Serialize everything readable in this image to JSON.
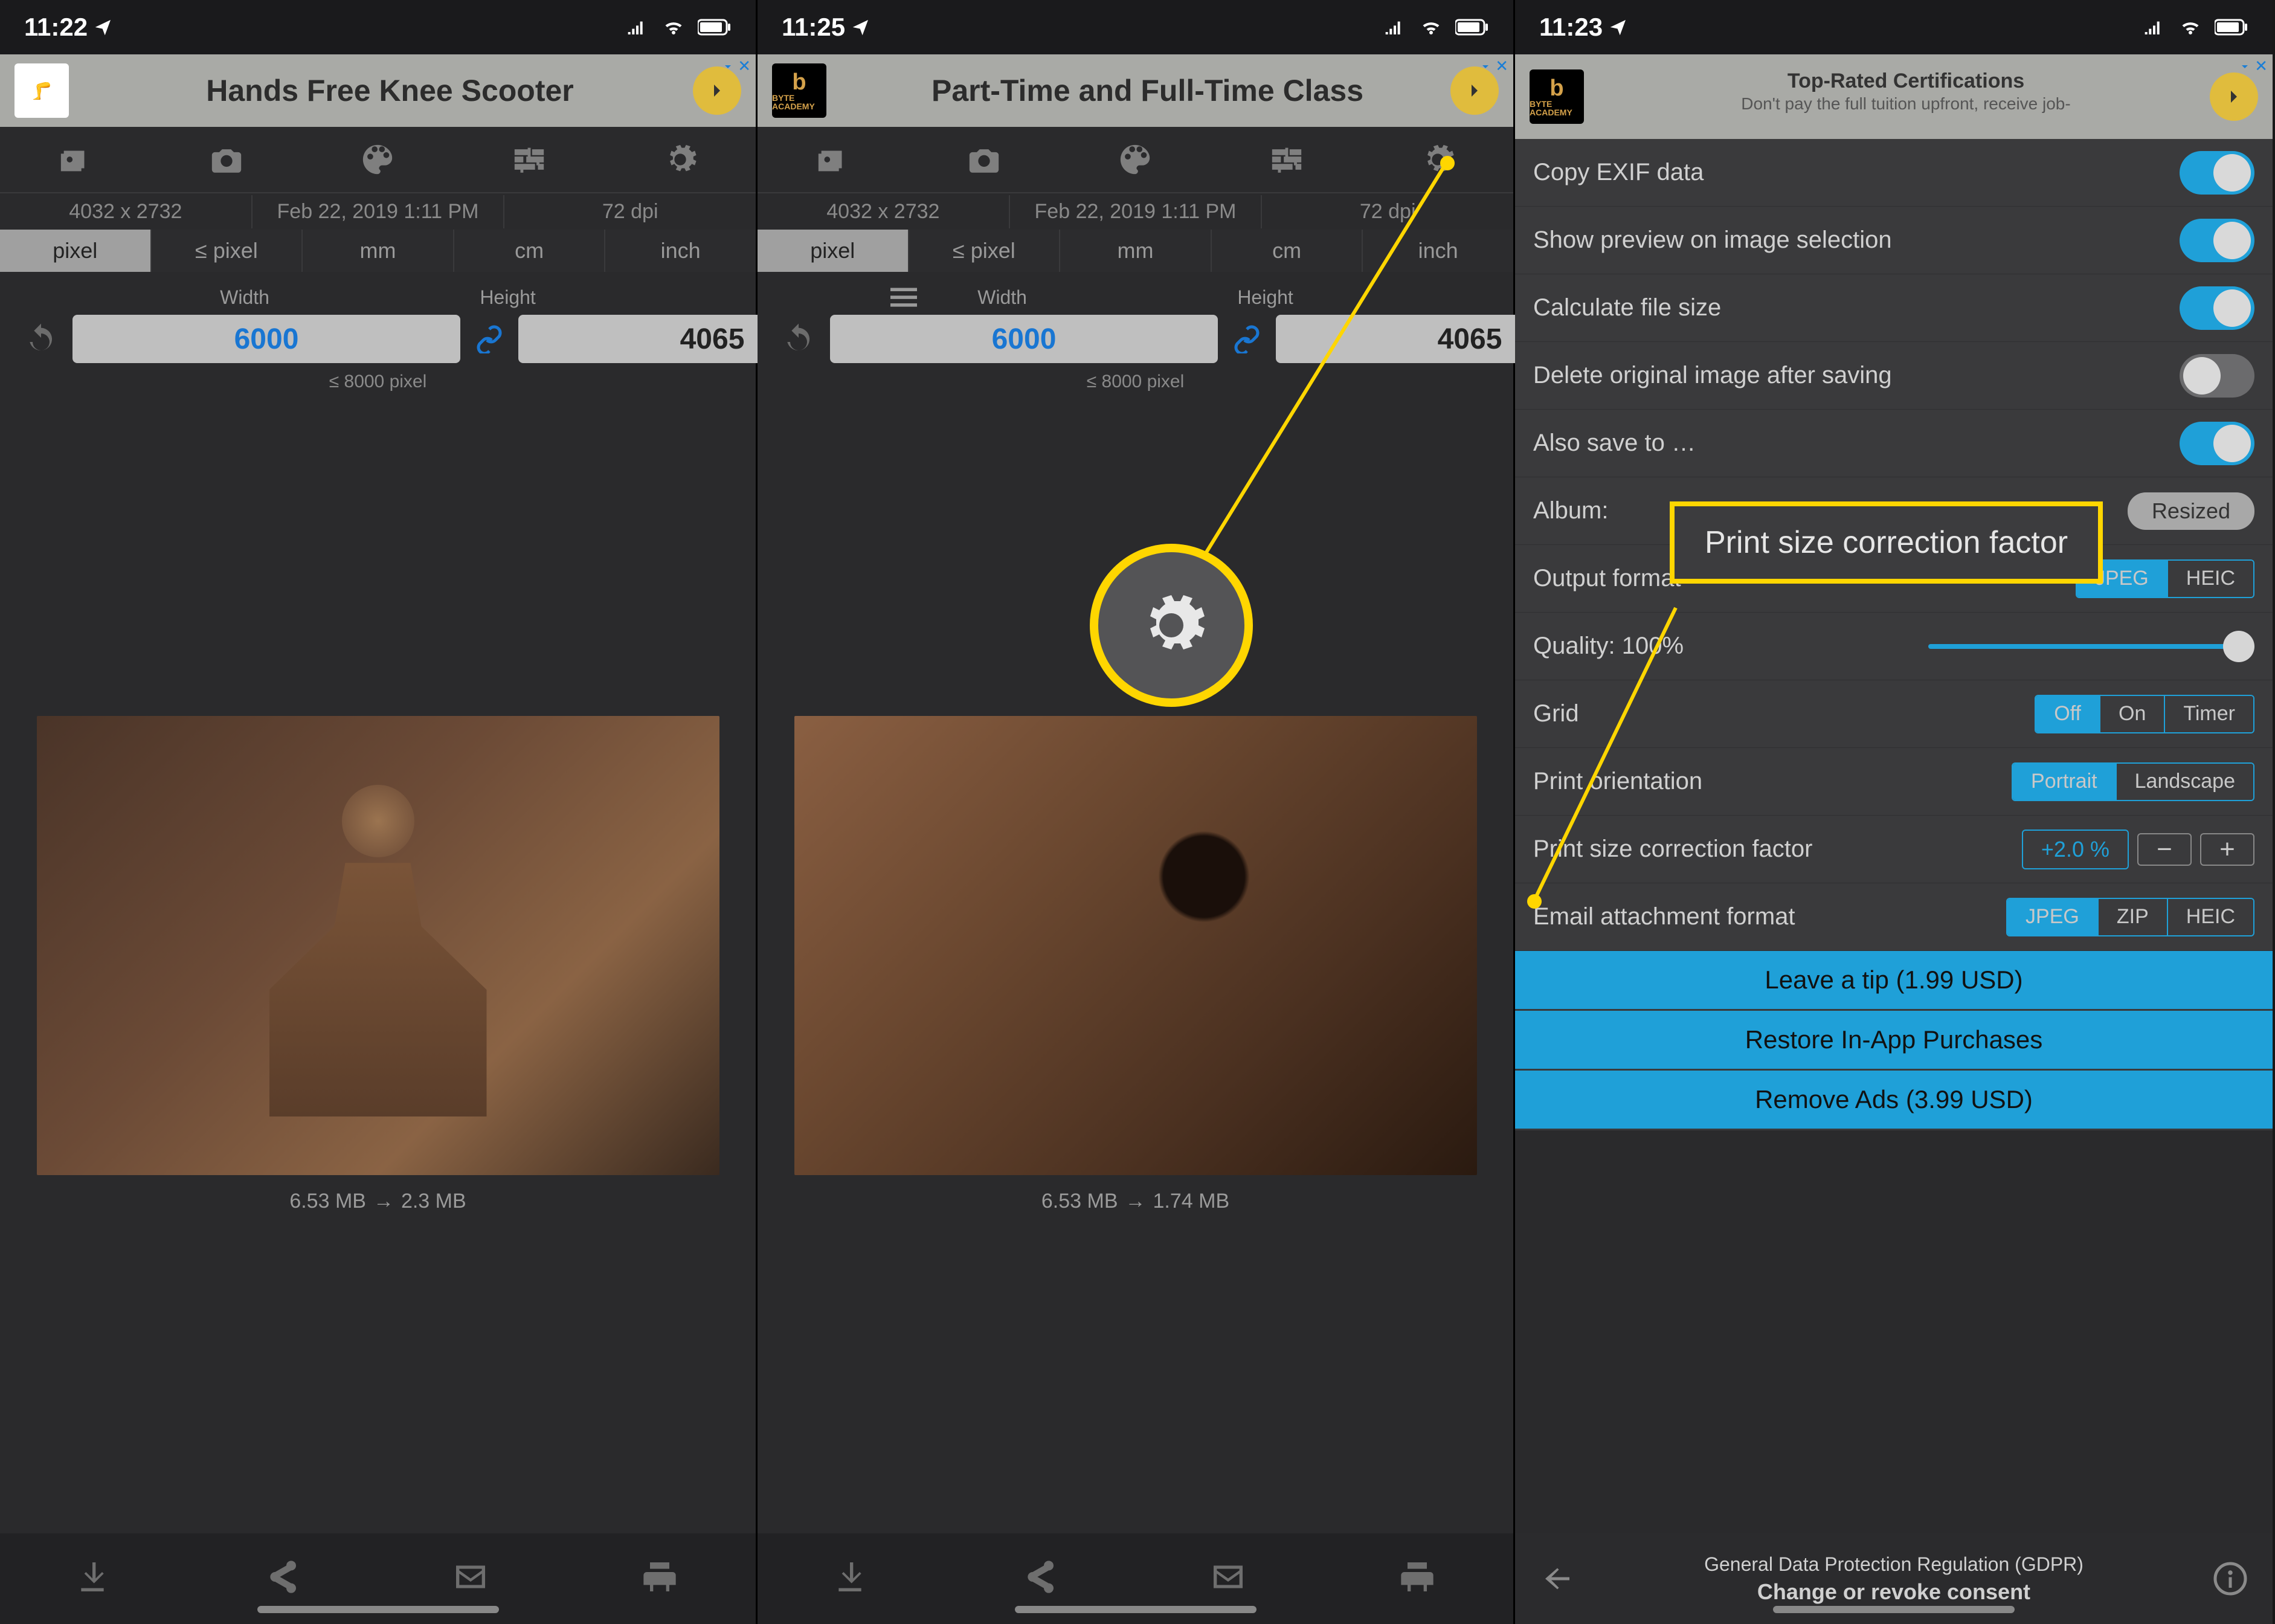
{
  "phone1": {
    "time": "11:22",
    "ad": {
      "text": "Hands Free Knee Scooter"
    },
    "info": {
      "dims": "4032 x 2732",
      "date": "Feb 22, 2019 1:11 PM",
      "dpi": "72 dpi"
    },
    "units": [
      "pixel",
      "≤ pixel",
      "mm",
      "cm",
      "inch"
    ],
    "width_label": "Width",
    "height_label": "Height",
    "width": "6000",
    "height": "4065",
    "hint": "≤ 8000 pixel",
    "caption_from": "6.53 MB",
    "caption_to": "2.3 MB"
  },
  "phone2": {
    "time": "11:25",
    "ad": {
      "text": "Part-Time and Full-Time Class"
    },
    "info": {
      "dims": "4032 x 2732",
      "date": "Feb 22, 2019 1:11 PM",
      "dpi": "72 dpi"
    },
    "units": [
      "pixel",
      "≤ pixel",
      "mm",
      "cm",
      "inch"
    ],
    "width_label": "Width",
    "height_label": "Height",
    "width": "6000",
    "height": "4065",
    "hint": "≤ 8000 pixel",
    "caption_from": "6.53 MB",
    "caption_to": "1.74 MB"
  },
  "phone3": {
    "time": "11:23",
    "ad": {
      "title": "Top-Rated Certifications",
      "sub": "Don't pay the full tuition upfront, receive job-"
    },
    "rows": {
      "copy_exif": "Copy EXIF data",
      "show_preview": "Show preview on image selection",
      "calc": "Calculate file size",
      "delete_orig": "Delete original image after saving",
      "also_save": "Also save to …",
      "album": "Album:",
      "album_val": "Resized",
      "output": "Output format",
      "quality": "Quality: 100%",
      "grid": "Grid",
      "print_orient": "Print orientation",
      "print_corr": "Print size correction factor",
      "print_corr_val": "+2.0 %",
      "email": "Email attachment format",
      "leave_tip": "Leave a tip (1.99 USD)",
      "restore": "Restore In-App Purchases",
      "remove_ads": "Remove Ads (3.99 USD)"
    },
    "seg_output": [
      "JPEG",
      "HEIC"
    ],
    "seg_grid": [
      "Off",
      "On",
      "Timer"
    ],
    "seg_orient": [
      "Portrait",
      "Landscape"
    ],
    "seg_email": [
      "JPEG",
      "ZIP",
      "HEIC"
    ],
    "gdpr": {
      "t1": "General Data Protection Regulation (GDPR)",
      "t2": "Change or revoke consent"
    }
  },
  "annotation": {
    "label": "Print size correction factor"
  }
}
